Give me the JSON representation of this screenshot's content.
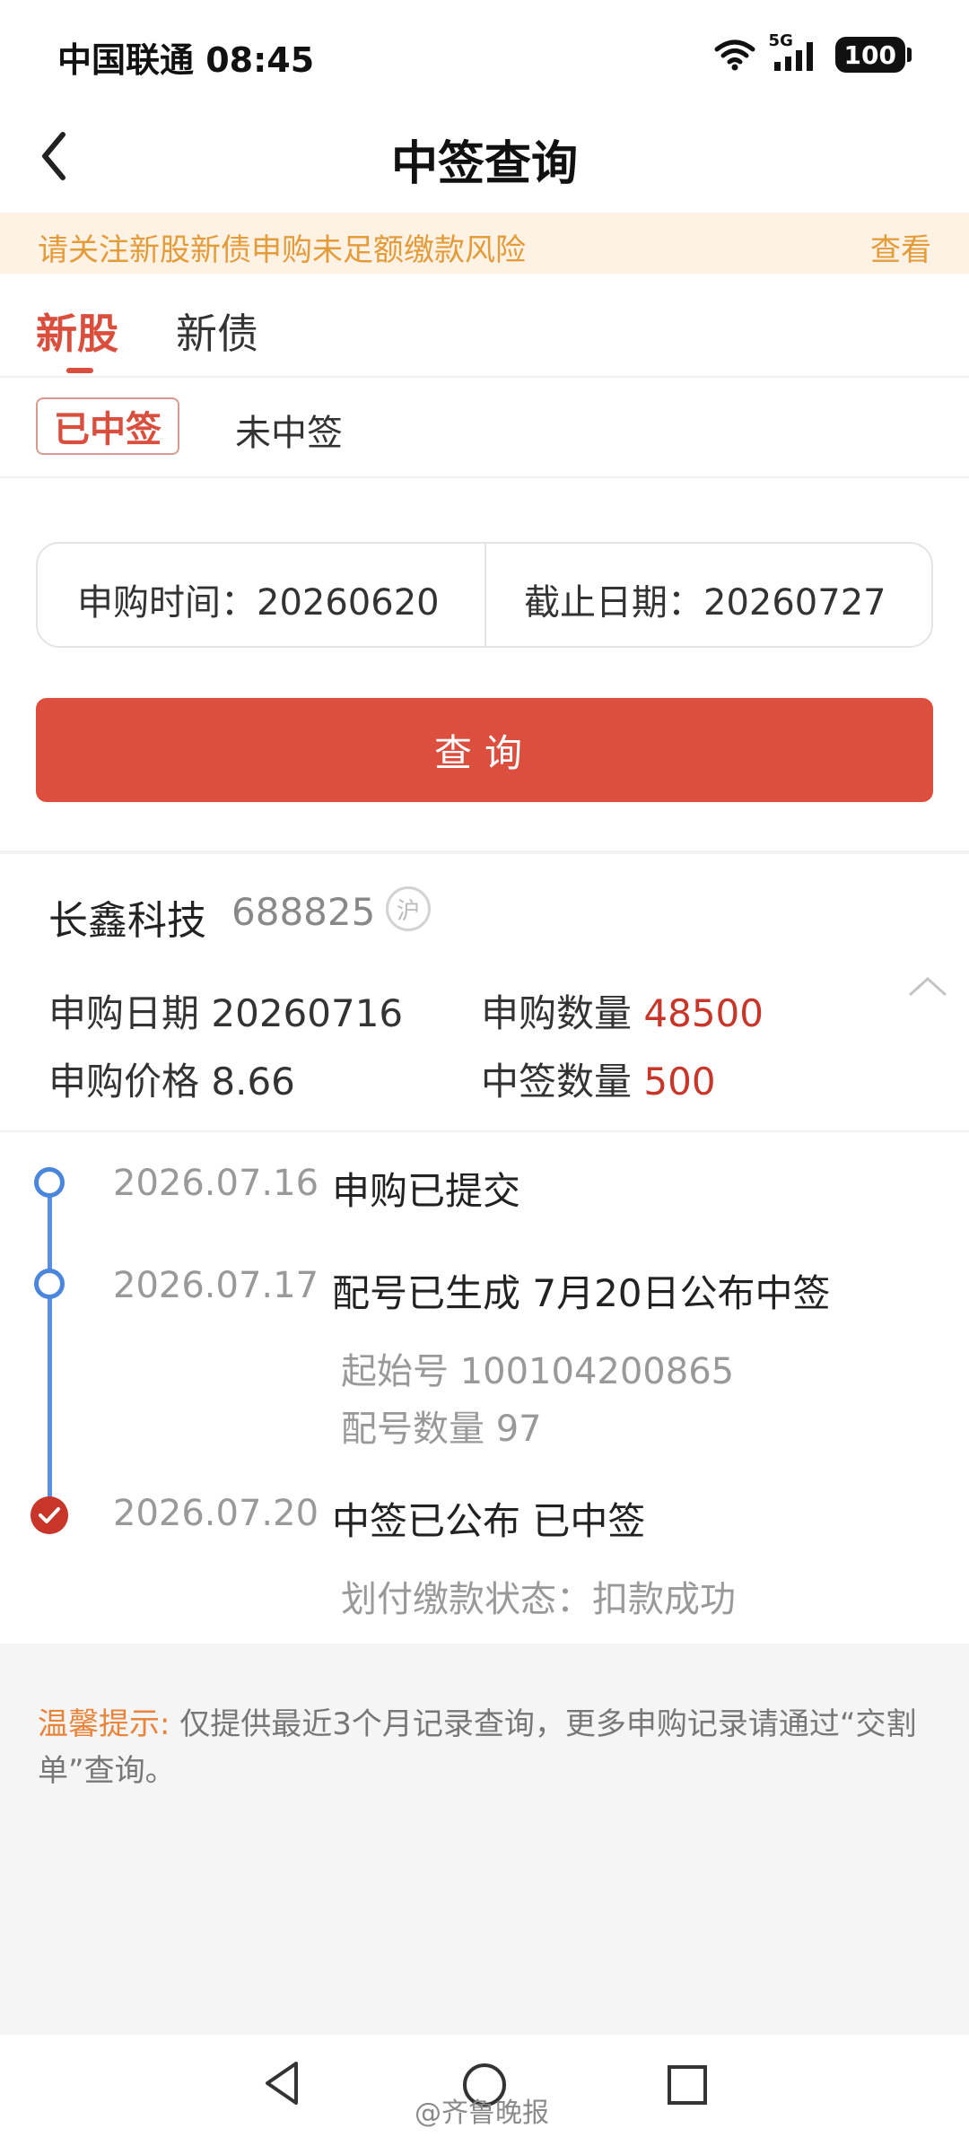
{
  "status": {
    "carrier_time": "中国联通 08:45",
    "network": "5G",
    "battery": "100"
  },
  "header": {
    "title": "中签查询"
  },
  "notice": {
    "text": "请关注新股新债申购未足额缴款风险",
    "link": "查看"
  },
  "tabs": [
    {
      "label": "新股",
      "active": true
    },
    {
      "label": "新债",
      "active": false
    }
  ],
  "filters": [
    {
      "label": "已中签",
      "active": true
    },
    {
      "label": "未中签",
      "active": false
    }
  ],
  "date_range": {
    "start": "申购时间：20260620",
    "end": "截止日期：20260727"
  },
  "query_button": "查询",
  "stock": {
    "name": "长鑫科技",
    "code": "688825",
    "exchange": "沪",
    "apply_date_label": "申购日期",
    "apply_date": "20260716",
    "apply_qty_label": "申购数量",
    "apply_qty": "48500",
    "price_label": "申购价格",
    "price": "8.66",
    "win_qty_label": "中签数量",
    "win_qty": "500"
  },
  "timeline": [
    {
      "date": "2026.07.16",
      "text": "申购已提交"
    },
    {
      "date": "2026.07.17",
      "text": "配号已生成 7月20日公布中签",
      "sub1": "起始号 100104200865",
      "sub2": "配号数量 97"
    },
    {
      "date": "2026.07.20",
      "text": "中签已公布 已中签",
      "sub1": "划付缴款状态：扣款成功"
    }
  ],
  "tip": {
    "label": "温馨提示:",
    "text": " 仅提供最近3个月记录查询，更多申购记录请通过“交割单”查询。"
  },
  "watermark": "@齐鲁晚报",
  "colors": {
    "accent": "#dc4e3e",
    "notice_text": "#e49b3a",
    "timeline": "#4a86dc"
  }
}
